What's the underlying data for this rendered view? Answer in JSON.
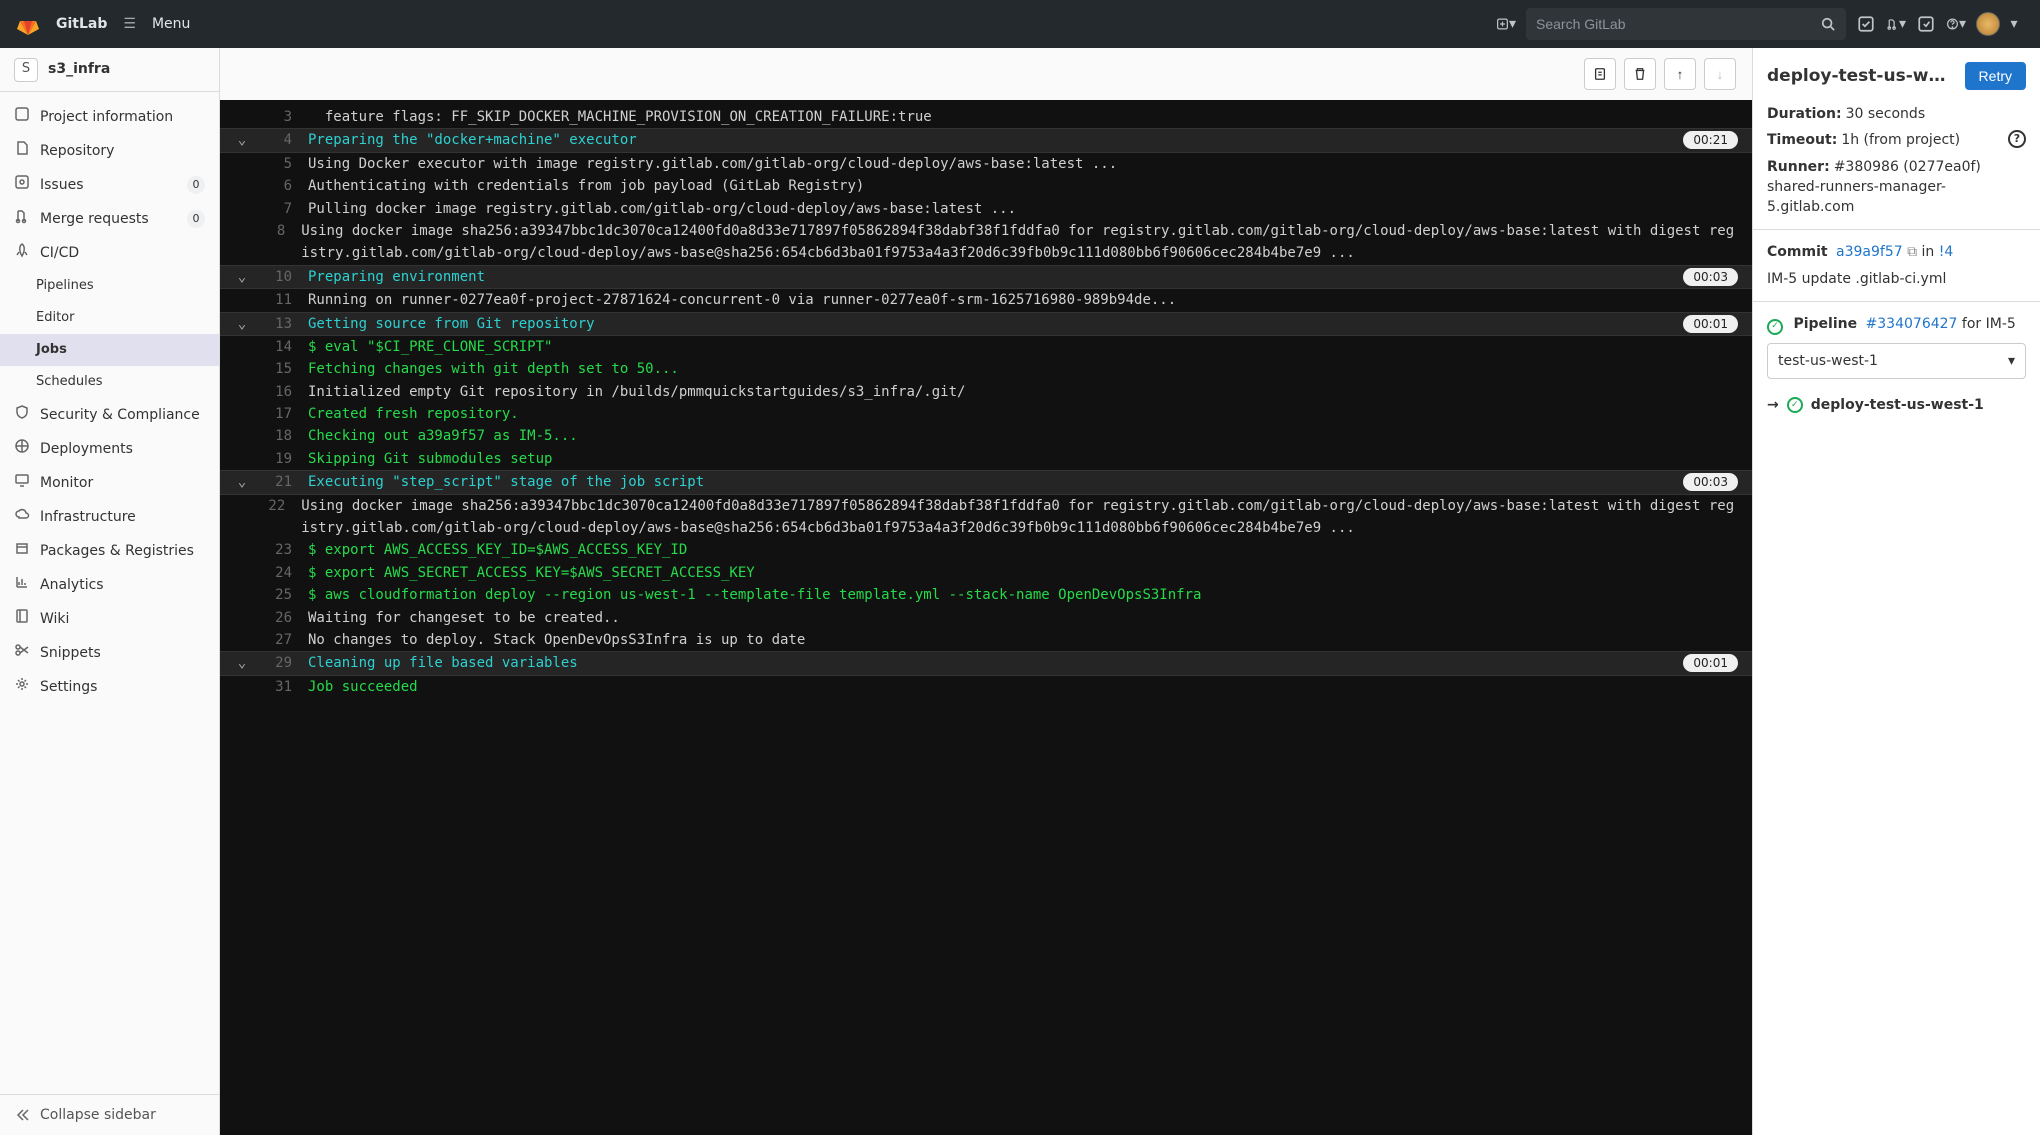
{
  "brand": "GitLab",
  "menu_label": "Menu",
  "search_placeholder": "Search GitLab",
  "sidebar": {
    "project_initial": "S",
    "project_name": "s3_infra",
    "collapse": "Collapse sidebar",
    "items": [
      {
        "label": "Project information",
        "icon": "info"
      },
      {
        "label": "Repository",
        "icon": "file"
      },
      {
        "label": "Issues",
        "icon": "issues",
        "badge": "0"
      },
      {
        "label": "Merge requests",
        "icon": "merge",
        "badge": "0"
      },
      {
        "label": "CI/CD",
        "icon": "rocket"
      }
    ],
    "ci_subitems": [
      "Pipelines",
      "Editor",
      "Jobs",
      "Schedules"
    ],
    "items2": [
      {
        "label": "Security & Compliance",
        "icon": "shield"
      },
      {
        "label": "Deployments",
        "icon": "deploy"
      },
      {
        "label": "Monitor",
        "icon": "monitor"
      },
      {
        "label": "Infrastructure",
        "icon": "cloud"
      },
      {
        "label": "Packages & Registries",
        "icon": "package"
      },
      {
        "label": "Analytics",
        "icon": "chart"
      },
      {
        "label": "Wiki",
        "icon": "book"
      },
      {
        "label": "Snippets",
        "icon": "scissors"
      },
      {
        "label": "Settings",
        "icon": "gear"
      }
    ]
  },
  "log": [
    {
      "n": 3,
      "t": "  feature flags: FF_SKIP_DOCKER_MACHINE_PROVISION_ON_CREATION_FAILURE:true"
    },
    {
      "n": 4,
      "t": "Preparing the \"docker+machine\" executor",
      "sec": "open",
      "time": "00:21",
      "cls": "cyan"
    },
    {
      "n": 5,
      "t": "Using Docker executor with image registry.gitlab.com/gitlab-org/cloud-deploy/aws-base:latest ..."
    },
    {
      "n": 6,
      "t": "Authenticating with credentials from job payload (GitLab Registry)"
    },
    {
      "n": 7,
      "t": "Pulling docker image registry.gitlab.com/gitlab-org/cloud-deploy/aws-base:latest ..."
    },
    {
      "n": 8,
      "t": "Using docker image sha256:a39347bbc1dc3070ca12400fd0a8d33e717897f05862894f38dabf38f1fddfa0 for registry.gitlab.com/gitlab-org/cloud-deploy/aws-base:latest with digest registry.gitlab.com/gitlab-org/cloud-deploy/aws-base@sha256:654cb6d3ba01f9753a4a3f20d6c39fb0b9c111d080bb6f90606cec284b4be7e9 ..."
    },
    {
      "n": 10,
      "t": "Preparing environment",
      "sec": "open",
      "time": "00:03",
      "cls": "cyan"
    },
    {
      "n": 11,
      "t": "Running on runner-0277ea0f-project-27871624-concurrent-0 via runner-0277ea0f-srm-1625716980-989b94de..."
    },
    {
      "n": 13,
      "t": "Getting source from Git repository",
      "sec": "open",
      "time": "00:01",
      "cls": "cyan"
    },
    {
      "n": 14,
      "t": "$ eval \"$CI_PRE_CLONE_SCRIPT\"",
      "cls": "green"
    },
    {
      "n": 15,
      "t": "Fetching changes with git depth set to 50...",
      "cls": "green"
    },
    {
      "n": 16,
      "t": "Initialized empty Git repository in /builds/pmmquickstartguides/s3_infra/.git/"
    },
    {
      "n": 17,
      "t": "Created fresh repository.",
      "cls": "green"
    },
    {
      "n": 18,
      "t": "Checking out a39a9f57 as IM-5...",
      "cls": "green"
    },
    {
      "n": 19,
      "t": "Skipping Git submodules setup",
      "cls": "green"
    },
    {
      "n": 21,
      "t": "Executing \"step_script\" stage of the job script",
      "sec": "open",
      "time": "00:03",
      "cls": "cyan"
    },
    {
      "n": 22,
      "t": "Using docker image sha256:a39347bbc1dc3070ca12400fd0a8d33e717897f05862894f38dabf38f1fddfa0 for registry.gitlab.com/gitlab-org/cloud-deploy/aws-base:latest with digest registry.gitlab.com/gitlab-org/cloud-deploy/aws-base@sha256:654cb6d3ba01f9753a4a3f20d6c39fb0b9c111d080bb6f90606cec284b4be7e9 ..."
    },
    {
      "n": 23,
      "t": "$ export AWS_ACCESS_KEY_ID=$AWS_ACCESS_KEY_ID",
      "cls": "green"
    },
    {
      "n": 24,
      "t": "$ export AWS_SECRET_ACCESS_KEY=$AWS_SECRET_ACCESS_KEY",
      "cls": "green"
    },
    {
      "n": 25,
      "t": "$ aws cloudformation deploy --region us-west-1 --template-file template.yml --stack-name OpenDevOpsS3Infra",
      "cls": "green"
    },
    {
      "n": 26,
      "t": "Waiting for changeset to be created.."
    },
    {
      "n": 27,
      "t": "No changes to deploy. Stack OpenDevOpsS3Infra is up to date"
    },
    {
      "n": 29,
      "t": "Cleaning up file based variables",
      "sec": "open",
      "time": "00:01",
      "cls": "cyan"
    },
    {
      "n": 31,
      "t": "Job succeeded",
      "cls": "green"
    }
  ],
  "details": {
    "title": "deploy-test-us-w…",
    "retry": "Retry",
    "duration_label": "Duration:",
    "duration": "30 seconds",
    "timeout_label": "Timeout:",
    "timeout": "1h (from project)",
    "runner_label": "Runner:",
    "runner": "#380986 (0277ea0f) shared-runners-manager-5.gitlab.com",
    "commit_label": "Commit",
    "commit_sha": "a39a9f57",
    "commit_in": "in",
    "commit_mr": "!4",
    "commit_msg": "IM-5 update .gitlab-ci.yml",
    "pipeline_label": "Pipeline",
    "pipeline_num": "#334076427",
    "pipeline_for": "for IM-5",
    "stage": "test-us-west-1",
    "job_name": "deploy-test-us-west-1"
  }
}
